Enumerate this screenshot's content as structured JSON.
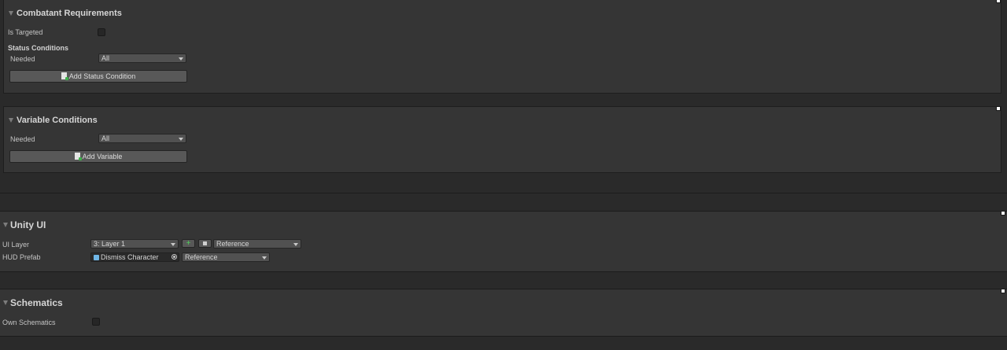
{
  "combatant": {
    "title": "Combatant Requirements",
    "is_targeted_label": "Is Targeted",
    "status_conditions_title": "Status Conditions",
    "needed_label": "Needed",
    "needed_value": "All",
    "add_button_label": "Add Status Condition"
  },
  "variable_conditions": {
    "title": "Variable Conditions",
    "needed_label": "Needed",
    "needed_value": "All",
    "add_button_label": "Add Variable"
  },
  "unity_ui": {
    "title": "Unity UI",
    "ui_layer_label": "UI Layer",
    "ui_layer_value": "3: Layer 1",
    "ui_layer_ref_value": "Reference",
    "hud_prefab_label": "HUD Prefab",
    "hud_prefab_value": "Dismiss Character",
    "hud_prefab_ref_value": "Reference"
  },
  "schematics": {
    "title": "Schematics",
    "own_schematics_label": "Own Schematics"
  },
  "icons": {
    "foldout": "triangle-down-icon",
    "add": "add-document-icon",
    "prefab": "prefab-cube-icon",
    "picker": "object-picker-icon",
    "handle": "resize-handle-icon"
  },
  "colors": {
    "background": "#2a2a2a",
    "panel": "#353535",
    "button": "#585858",
    "accent_green": "#3fb04b"
  }
}
